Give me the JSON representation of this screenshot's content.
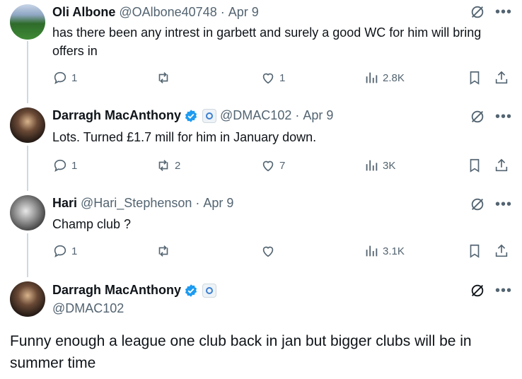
{
  "tweets": [
    {
      "name": "Oli Albone",
      "handle": "@OAlbone40748",
      "date": "Apr 9",
      "text": "has there been any intrest in garbett and surely a good WC for him will bring offers in",
      "replies": "1",
      "reposts": "",
      "likes": "1",
      "views": "2.8K"
    },
    {
      "name": "Darragh MacAnthony",
      "handle": "@DMAC102",
      "date": "Apr 9",
      "text": "Lots. Turned £1.7 mill for him in January down.",
      "replies": "1",
      "reposts": "2",
      "likes": "7",
      "views": "3K"
    },
    {
      "name": "Hari",
      "handle": "@Hari_Stephenson",
      "date": "Apr 9",
      "text": "Champ club ?",
      "replies": "1",
      "reposts": "",
      "likes": "",
      "views": "3.1K"
    }
  ],
  "main_tweet": {
    "name": "Darragh MacAnthony",
    "handle": "@DMAC102",
    "text": "Funny enough a league one club back in jan but bigger clubs will be in summer time"
  },
  "separator": "·",
  "colors": {
    "verified": "#1d9bf0",
    "muted": "#536471",
    "thread_line": "#cfd9de"
  }
}
